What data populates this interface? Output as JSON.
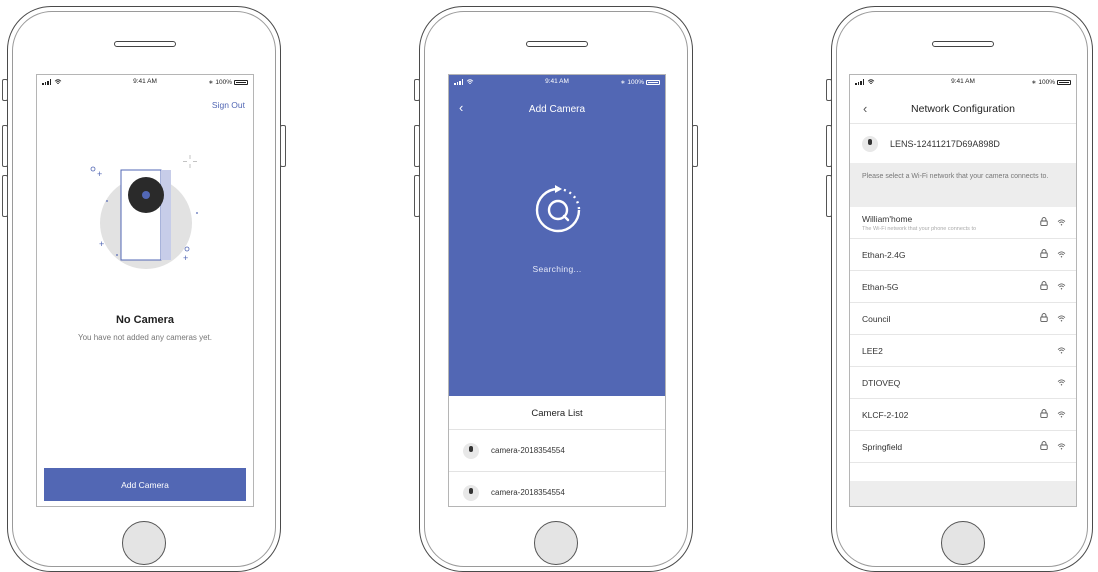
{
  "status_bar": {
    "time": "9:41 AM",
    "battery": "100%"
  },
  "screen1": {
    "sign_out": "Sign Out",
    "title": "No Camera",
    "subtitle": "You have not added any cameras yet.",
    "add_button": "Add Camera"
  },
  "screen2": {
    "title": "Add Camera",
    "searching": "Searching...",
    "list_title": "Camera List",
    "cameras": [
      "camera-2018354554",
      "camera-2018354554"
    ]
  },
  "screen3": {
    "title": "Network Configuration",
    "device": "LENS-12411217D69A898D",
    "notice": "Please select a Wi-Fi network that your camera connects to.",
    "networks": [
      {
        "name": "William'home",
        "sub": "The Wi-Fi network that your phone connects to",
        "locked": true
      },
      {
        "name": "Ethan-2.4G",
        "locked": true
      },
      {
        "name": "Ethan-5G",
        "locked": true
      },
      {
        "name": "Council",
        "locked": true
      },
      {
        "name": "LEE2",
        "locked": false
      },
      {
        "name": "DTIOVEQ",
        "locked": false
      },
      {
        "name": "KLCF-2-102",
        "locked": true
      },
      {
        "name": "Springfield",
        "locked": true
      }
    ]
  },
  "colors": {
    "accent": "#5267b4",
    "grey_bg": "#ededed"
  }
}
